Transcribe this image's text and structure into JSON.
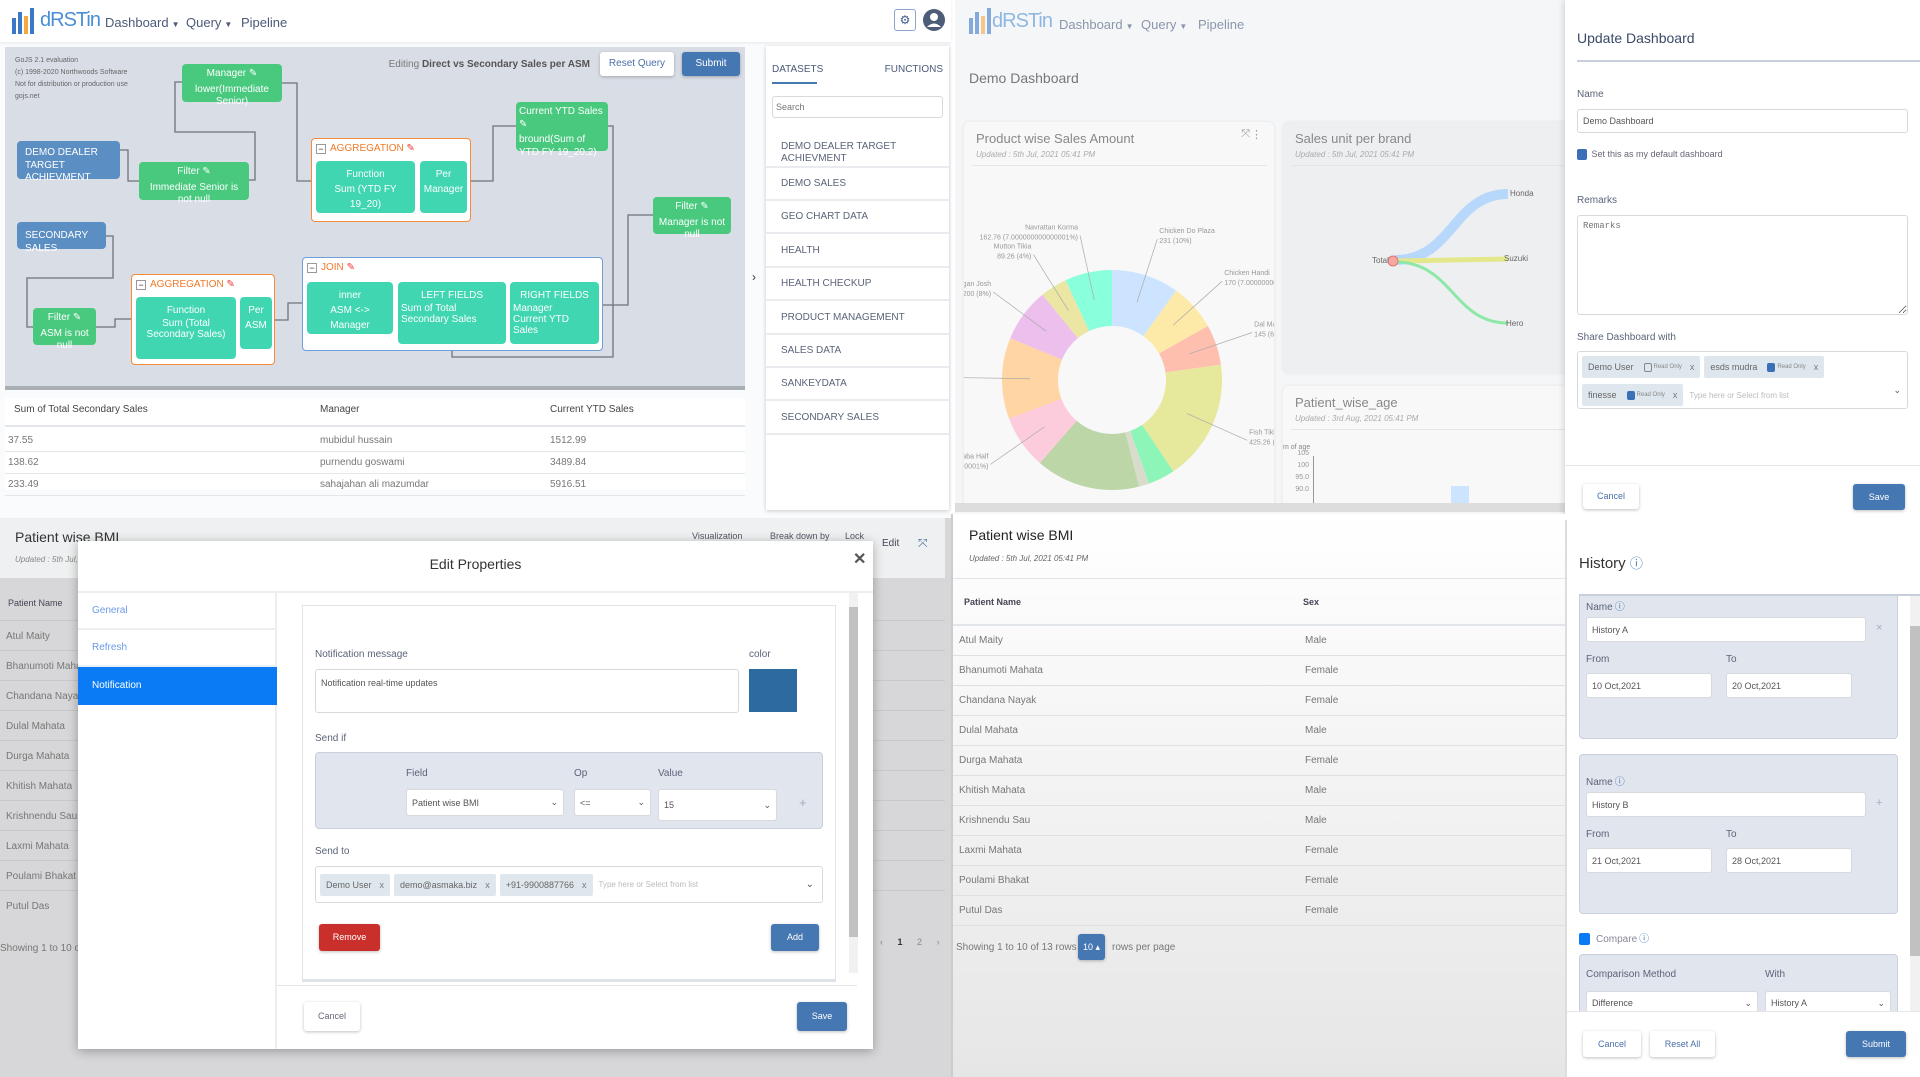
{
  "brand": {
    "logo_text": "dRSTin",
    "accent": "#4a8ed6"
  },
  "nav": {
    "items": [
      "Dashboard",
      "Query",
      "Pipeline"
    ],
    "dropdown_items": [
      0,
      1
    ]
  },
  "query_editor": {
    "gojs_notice": [
      "GoJS 2.1 evaluation",
      "(c) 1998-2020 Northwoods Software",
      "Not for distribution or production use",
      "gojs.net"
    ],
    "editing_prefix": "Editing",
    "editing_name": "Direct vs Secondary Sales per ASM",
    "reset_label": "Reset Query",
    "submit_label": "Submit",
    "nodes": {
      "demo_dealer": "DEMO DEALER TARGET ACHIEVMENT",
      "secondary": "SECONDARY SALES",
      "manager": {
        "title": "Manager",
        "expr": "lower(Immediate Senior)"
      },
      "filter1": {
        "title": "Filter",
        "expr": "Immediate Senior is not null"
      },
      "agg1": {
        "label": "AGGREGATION",
        "function_title": "Function",
        "function_expr": "Sum (YTD FY 19_20)",
        "per_title": "Per",
        "per_value": "Manager"
      },
      "current_ytd": {
        "title": "Current YTD Sales",
        "expr": "bround(Sum of YTD FY 19_20,2)"
      },
      "filter3": {
        "title": "Filter",
        "expr": "Manager is not null"
      },
      "filter2": {
        "title": "Filter",
        "expr": "ASM is not null"
      },
      "agg2": {
        "label": "AGGREGATION",
        "function_title": "Function",
        "function_expr": "Sum (Total Secondary Sales)",
        "per_title": "Per",
        "per_value": "ASM"
      },
      "join": {
        "label": "JOIN",
        "type": "inner",
        "on": "ASM <-> Manager",
        "left_title": "LEFT FIELDS",
        "left_value": "Sum of Total Secondary Sales",
        "right_title": "RIGHT FIELDS",
        "right_value": "Manager\nCurrent YTD Sales"
      }
    },
    "result_table": {
      "columns": [
        "Sum of Total Secondary Sales",
        "Manager",
        "Current YTD Sales"
      ],
      "rows": [
        [
          "37.55",
          "mubidul hussain",
          "1512.99"
        ],
        [
          "138.62",
          "purnendu goswami",
          "3489.84"
        ],
        [
          "233.49",
          "sahajahan ali mazumdar",
          "5916.51"
        ]
      ]
    }
  },
  "datasets_panel": {
    "tabs": [
      "DATASETS",
      "FUNCTIONS"
    ],
    "active_tab": 0,
    "search_placeholder": "Search",
    "items": [
      "DEMO DEALER TARGET ACHIEVMENT",
      "DEMO SALES",
      "GEO CHART DATA",
      "HEALTH",
      "HEALTH CHECKUP",
      "PRODUCT MANAGEMENT",
      "SALES DATA",
      "SANKEYDATA",
      "SECONDARY SALES"
    ]
  },
  "dashboard": {
    "title": "Demo Dashboard",
    "product_card": {
      "title": "Product wise Sales Amount",
      "updated": "Updated : 5th Jul, 2021 05:41 PM"
    },
    "sankey_card": {
      "title": "Sales unit per brand",
      "updated": "Updated : 5th Jul, 2021 05:41 PM",
      "source": "Total",
      "targets": [
        "Honda",
        "Suzuki",
        "Hero"
      ],
      "colors": [
        "#b8d8fb",
        "#e3e88a",
        "#8de8a8"
      ]
    },
    "age_card": {
      "title": "Patient_wise_age",
      "updated": "Updated : 3rd Aug, 2021 05:41 PM"
    }
  },
  "chart_data": [
    {
      "type": "pie",
      "variant": "donut",
      "labels": [
        "Chicken Do Plaza",
        "Chicken Handi",
        "Dal Mak",
        "Fish Tikk",
        "",
        "",
        "",
        "Kebaba Half",
        "asala",
        "n Rogan Josh",
        "Mutton Tikia",
        "Navrattan Korma"
      ],
      "value_labels": [
        "231 (10%)",
        "170 (7.000000000",
        "145 (6%",
        "425.26 (1",
        "",
        "",
        "",
        "000000001%)",
        "(12%)",
        "200 (8%)",
        "89.26 (4%)",
        "162.76 (7.000000000000001%)"
      ],
      "percent": [
        10,
        7,
        6,
        18,
        4,
        1.5,
        15.5,
        8,
        12,
        8,
        4,
        7
      ],
      "colors": [
        "#cce4ff",
        "#fde9a8",
        "#ffbfae",
        "#e6e89c",
        "#8ef5b8",
        "#d9dccb",
        "#bcd6a8",
        "#fcccdc",
        "#fed5a3",
        "#ecbfec",
        "#ebe6a3",
        "#8affdc"
      ]
    },
    {
      "type": "bar",
      "ylabel": "m of age",
      "yticks": [
        "105",
        "100",
        "95.0",
        "90.0"
      ],
      "ylim": [
        85,
        105
      ],
      "values": [
        95
      ]
    }
  ],
  "update_dashboard": {
    "title": "Update Dashboard",
    "name_label": "Name",
    "name_value": "Demo Dashboard",
    "default_label": "Set this as my default dashboard",
    "default_checked": true,
    "remarks_label": "Remarks",
    "remarks_placeholder": "Remarks",
    "share_label": "Share Dashboard with",
    "share_chips": [
      {
        "name": "Demo User",
        "read_only": false
      },
      {
        "name": "esds mudra",
        "read_only": true
      },
      {
        "name": "finesse",
        "read_only": true
      }
    ],
    "read_only_label": "Read Only",
    "share_placeholder": "Type here or Select from list",
    "cancel": "Cancel",
    "save": "Save"
  },
  "bmi_left": {
    "title": "Patient wise BMI",
    "updated": "Updated : 5th Jul, 2",
    "header_links": [
      "Visualization",
      "Break down by",
      "Lock"
    ],
    "edit": "Edit",
    "column": "Patient Name",
    "showing": "Showing 1 to 10 of",
    "pages": [
      "‹",
      "1",
      "2",
      "›"
    ]
  },
  "edit_properties": {
    "title": "Edit Properties",
    "tabs": [
      "General",
      "Refresh",
      "Notification"
    ],
    "active_tab": 2,
    "message_label": "Notification message",
    "message_value": "Notification real-time updates",
    "color_label": "color",
    "color_value": "#2c6aa0",
    "send_if_label": "Send if",
    "field_label": "Field",
    "op_label": "Op",
    "value_label": "Value",
    "field_value": "Patient wise BMI",
    "op_value": "<=",
    "value_value": "15",
    "send_to_label": "Send to",
    "send_to_chips": [
      "Demo User",
      "demo@asmaka.biz",
      "+91-9900887766"
    ],
    "send_to_placeholder": "Type here or Select from list",
    "remove": "Remove",
    "add": "Add",
    "cancel": "Cancel",
    "save": "Save"
  },
  "bmi_table": {
    "title": "Patient wise BMI",
    "updated": "Updated : 5th Jul, 2021 05:41 PM",
    "columns": [
      "Patient Name",
      "Sex"
    ],
    "rows": [
      [
        "Atul Maity",
        "Male"
      ],
      [
        "Bhanumoti Mahata",
        "Female"
      ],
      [
        "Chandana Nayak",
        "Female"
      ],
      [
        "Dulal Mahata",
        "Male"
      ],
      [
        "Durga Mahata",
        "Female"
      ],
      [
        "Khitish Mahata",
        "Male"
      ],
      [
        "Krishnendu Sau",
        "Male"
      ],
      [
        "Laxmi Mahata",
        "Female"
      ],
      [
        "Poulami Bhakat",
        "Female"
      ],
      [
        "Putul Das",
        "Female"
      ]
    ],
    "showing": "Showing 1 to 10 of 13 rows",
    "page_size": "10",
    "rows_per_page": "rows per page"
  },
  "history": {
    "title": "History",
    "entries": [
      {
        "name_label": "Name",
        "name": "History A",
        "from_label": "From",
        "from": "10 Oct,2021",
        "to_label": "To",
        "to": "20 Oct,2021"
      },
      {
        "name_label": "Name",
        "name": "History B",
        "from_label": "From",
        "from": "21 Oct,2021",
        "to_label": "To",
        "to": "28 Oct,2021"
      }
    ],
    "compare_label": "Compare",
    "compare_checked": true,
    "method_label": "Comparison Method",
    "method_value": "Difference",
    "with_label": "With",
    "with_value": "History A",
    "cancel": "Cancel",
    "reset": "Reset All",
    "submit": "Submit"
  }
}
